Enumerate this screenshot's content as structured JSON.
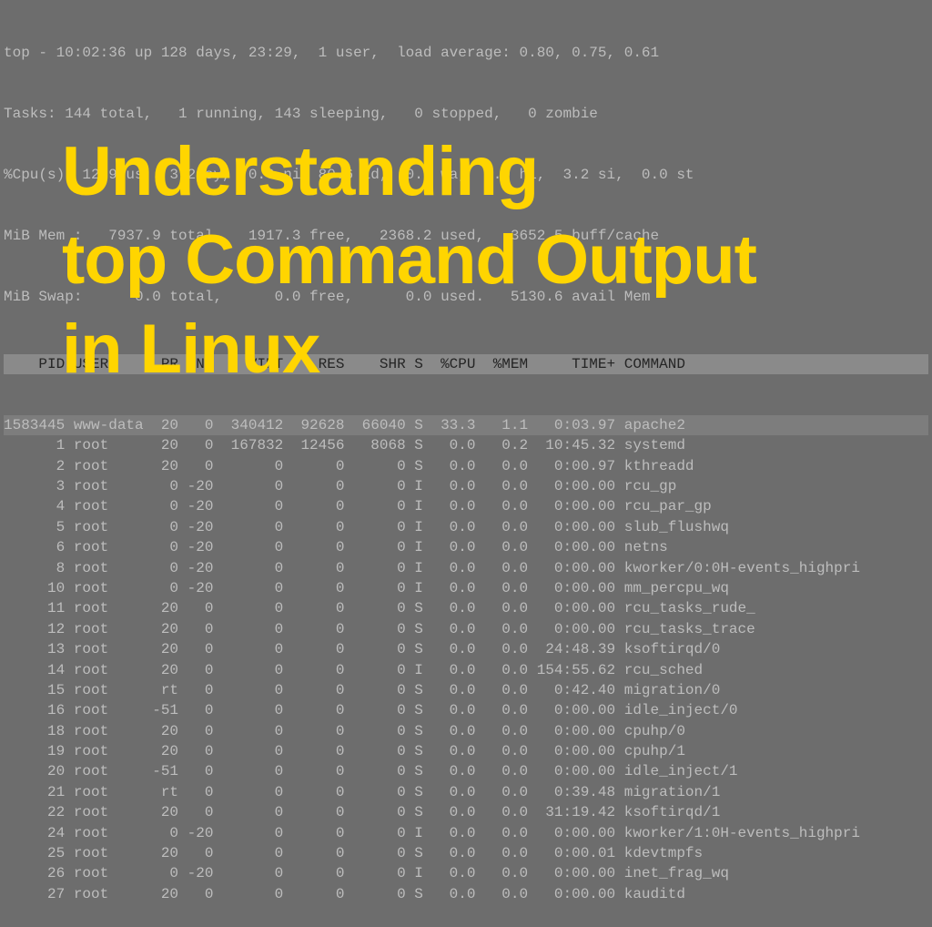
{
  "summary": {
    "line1": "top - 10:02:36 up 128 days, 23:29,  1 user,  load average: 0.80, 0.75, 0.61",
    "line2": "Tasks: 144 total,   1 running, 143 sleeping,   0 stopped,   0 zombie",
    "line3": "%Cpu(s): 12.9 us,  3.2 sy,  0.0 ni, 80.6 id,  0.0 wa,  0.0 hi,  3.2 si,  0.0 st",
    "line4": "MiB Mem :   7937.9 total,   1917.3 free,   2368.2 used,   3652.5 buff/cache",
    "line5": "MiB Swap:      0.0 total,      0.0 free,      0.0 used.   5130.6 avail Mem"
  },
  "header": "    PID USER      PR  NI    VIRT    RES    SHR S  %CPU  %MEM     TIME+ COMMAND                ",
  "processes": [
    {
      "pid": "1583445",
      "user": "www-data",
      "pr": "20",
      "ni": "0",
      "virt": "340412",
      "res": "92628",
      "shr": "66040",
      "s": "S",
      "cpu": "33.3",
      "mem": "1.1",
      "time": "0:03.97",
      "cmd": "apache2"
    },
    {
      "pid": "1",
      "user": "root",
      "pr": "20",
      "ni": "0",
      "virt": "167832",
      "res": "12456",
      "shr": "8068",
      "s": "S",
      "cpu": "0.0",
      "mem": "0.2",
      "time": "10:45.32",
      "cmd": "systemd"
    },
    {
      "pid": "2",
      "user": "root",
      "pr": "20",
      "ni": "0",
      "virt": "0",
      "res": "0",
      "shr": "0",
      "s": "S",
      "cpu": "0.0",
      "mem": "0.0",
      "time": "0:00.97",
      "cmd": "kthreadd"
    },
    {
      "pid": "3",
      "user": "root",
      "pr": "0",
      "ni": "-20",
      "virt": "0",
      "res": "0",
      "shr": "0",
      "s": "I",
      "cpu": "0.0",
      "mem": "0.0",
      "time": "0:00.00",
      "cmd": "rcu_gp"
    },
    {
      "pid": "4",
      "user": "root",
      "pr": "0",
      "ni": "-20",
      "virt": "0",
      "res": "0",
      "shr": "0",
      "s": "I",
      "cpu": "0.0",
      "mem": "0.0",
      "time": "0:00.00",
      "cmd": "rcu_par_gp"
    },
    {
      "pid": "5",
      "user": "root",
      "pr": "0",
      "ni": "-20",
      "virt": "0",
      "res": "0",
      "shr": "0",
      "s": "I",
      "cpu": "0.0",
      "mem": "0.0",
      "time": "0:00.00",
      "cmd": "slub_flushwq"
    },
    {
      "pid": "6",
      "user": "root",
      "pr": "0",
      "ni": "-20",
      "virt": "0",
      "res": "0",
      "shr": "0",
      "s": "I",
      "cpu": "0.0",
      "mem": "0.0",
      "time": "0:00.00",
      "cmd": "netns"
    },
    {
      "pid": "8",
      "user": "root",
      "pr": "0",
      "ni": "-20",
      "virt": "0",
      "res": "0",
      "shr": "0",
      "s": "I",
      "cpu": "0.0",
      "mem": "0.0",
      "time": "0:00.00",
      "cmd": "kworker/0:0H-events_highpri"
    },
    {
      "pid": "10",
      "user": "root",
      "pr": "0",
      "ni": "-20",
      "virt": "0",
      "res": "0",
      "shr": "0",
      "s": "I",
      "cpu": "0.0",
      "mem": "0.0",
      "time": "0:00.00",
      "cmd": "mm_percpu_wq"
    },
    {
      "pid": "11",
      "user": "root",
      "pr": "20",
      "ni": "0",
      "virt": "0",
      "res": "0",
      "shr": "0",
      "s": "S",
      "cpu": "0.0",
      "mem": "0.0",
      "time": "0:00.00",
      "cmd": "rcu_tasks_rude_"
    },
    {
      "pid": "12",
      "user": "root",
      "pr": "20",
      "ni": "0",
      "virt": "0",
      "res": "0",
      "shr": "0",
      "s": "S",
      "cpu": "0.0",
      "mem": "0.0",
      "time": "0:00.00",
      "cmd": "rcu_tasks_trace"
    },
    {
      "pid": "13",
      "user": "root",
      "pr": "20",
      "ni": "0",
      "virt": "0",
      "res": "0",
      "shr": "0",
      "s": "S",
      "cpu": "0.0",
      "mem": "0.0",
      "time": "24:48.39",
      "cmd": "ksoftirqd/0"
    },
    {
      "pid": "14",
      "user": "root",
      "pr": "20",
      "ni": "0",
      "virt": "0",
      "res": "0",
      "shr": "0",
      "s": "I",
      "cpu": "0.0",
      "mem": "0.0",
      "time": "154:55.62",
      "cmd": "rcu_sched"
    },
    {
      "pid": "15",
      "user": "root",
      "pr": "rt",
      "ni": "0",
      "virt": "0",
      "res": "0",
      "shr": "0",
      "s": "S",
      "cpu": "0.0",
      "mem": "0.0",
      "time": "0:42.40",
      "cmd": "migration/0"
    },
    {
      "pid": "16",
      "user": "root",
      "pr": "-51",
      "ni": "0",
      "virt": "0",
      "res": "0",
      "shr": "0",
      "s": "S",
      "cpu": "0.0",
      "mem": "0.0",
      "time": "0:00.00",
      "cmd": "idle_inject/0"
    },
    {
      "pid": "18",
      "user": "root",
      "pr": "20",
      "ni": "0",
      "virt": "0",
      "res": "0",
      "shr": "0",
      "s": "S",
      "cpu": "0.0",
      "mem": "0.0",
      "time": "0:00.00",
      "cmd": "cpuhp/0"
    },
    {
      "pid": "19",
      "user": "root",
      "pr": "20",
      "ni": "0",
      "virt": "0",
      "res": "0",
      "shr": "0",
      "s": "S",
      "cpu": "0.0",
      "mem": "0.0",
      "time": "0:00.00",
      "cmd": "cpuhp/1"
    },
    {
      "pid": "20",
      "user": "root",
      "pr": "-51",
      "ni": "0",
      "virt": "0",
      "res": "0",
      "shr": "0",
      "s": "S",
      "cpu": "0.0",
      "mem": "0.0",
      "time": "0:00.00",
      "cmd": "idle_inject/1"
    },
    {
      "pid": "21",
      "user": "root",
      "pr": "rt",
      "ni": "0",
      "virt": "0",
      "res": "0",
      "shr": "0",
      "s": "S",
      "cpu": "0.0",
      "mem": "0.0",
      "time": "0:39.48",
      "cmd": "migration/1"
    },
    {
      "pid": "22",
      "user": "root",
      "pr": "20",
      "ni": "0",
      "virt": "0",
      "res": "0",
      "shr": "0",
      "s": "S",
      "cpu": "0.0",
      "mem": "0.0",
      "time": "31:19.42",
      "cmd": "ksoftirqd/1"
    },
    {
      "pid": "24",
      "user": "root",
      "pr": "0",
      "ni": "-20",
      "virt": "0",
      "res": "0",
      "shr": "0",
      "s": "I",
      "cpu": "0.0",
      "mem": "0.0",
      "time": "0:00.00",
      "cmd": "kworker/1:0H-events_highpri"
    },
    {
      "pid": "25",
      "user": "root",
      "pr": "20",
      "ni": "0",
      "virt": "0",
      "res": "0",
      "shr": "0",
      "s": "S",
      "cpu": "0.0",
      "mem": "0.0",
      "time": "0:00.01",
      "cmd": "kdevtmpfs"
    },
    {
      "pid": "26",
      "user": "root",
      "pr": "0",
      "ni": "-20",
      "virt": "0",
      "res": "0",
      "shr": "0",
      "s": "I",
      "cpu": "0.0",
      "mem": "0.0",
      "time": "0:00.00",
      "cmd": "inet_frag_wq"
    },
    {
      "pid": "27",
      "user": "root",
      "pr": "20",
      "ni": "0",
      "virt": "0",
      "res": "0",
      "shr": "0",
      "s": "S",
      "cpu": "0.0",
      "mem": "0.0",
      "time": "0:00.00",
      "cmd": "kauditd"
    }
  ],
  "overlay": {
    "line1": "Understanding",
    "line2": "top Command Output",
    "line3": "in Linux"
  }
}
